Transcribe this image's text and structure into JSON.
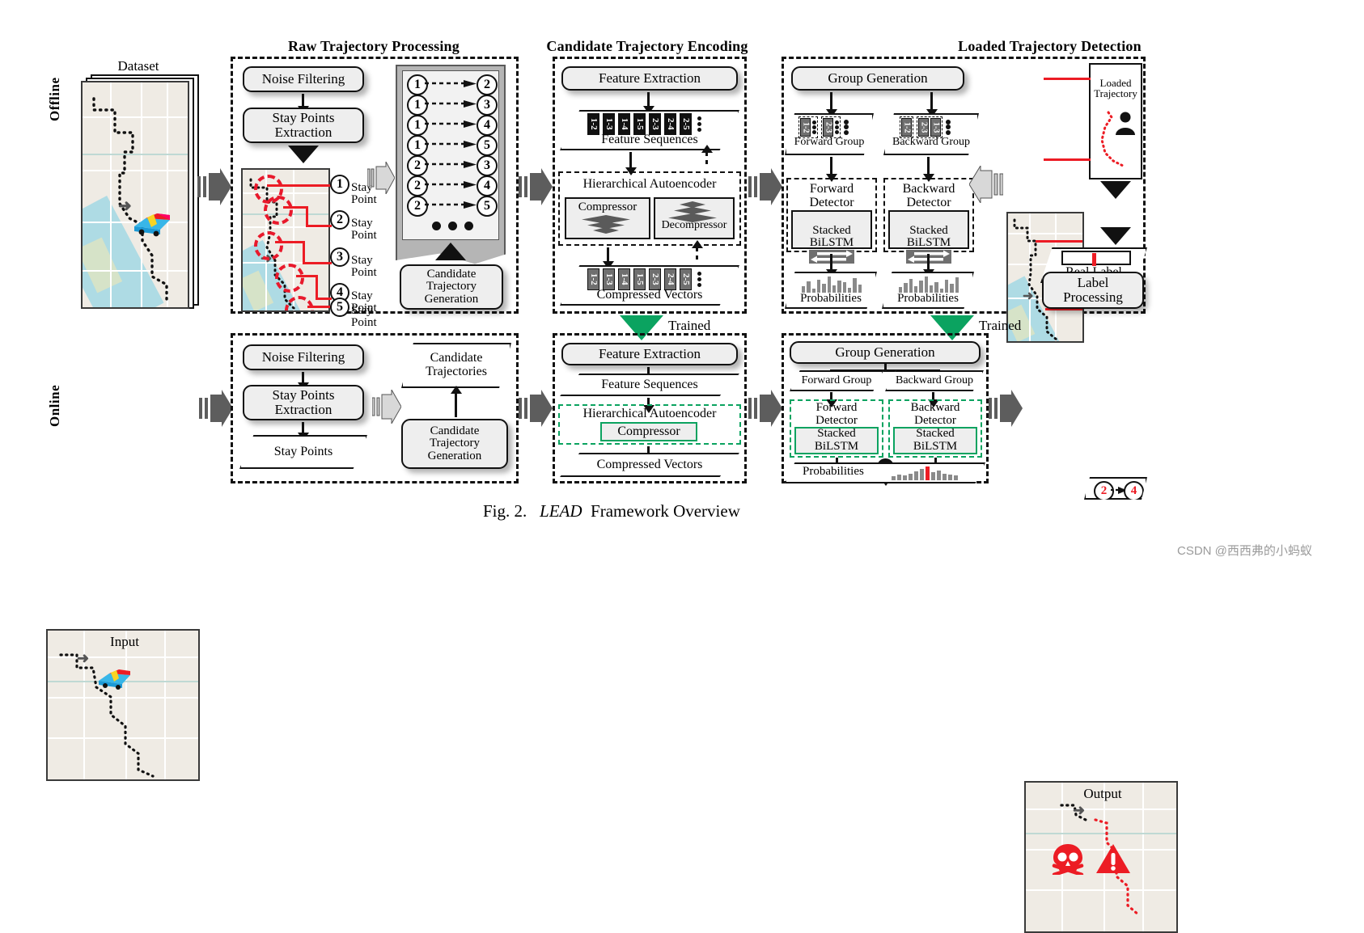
{
  "figure": {
    "caption_prefix": "Fig. 2.",
    "caption_name": "LEAD",
    "caption_rest": "Framework Overview",
    "watermark": "CSDN @西西弗的小蚂蚁"
  },
  "colors": {
    "green": "#0ba360",
    "red": "#ec1c24",
    "grey_box": "#eeeeee",
    "dark_card": "#111111",
    "grey_card": "#6f6f6f"
  },
  "row_labels": {
    "offline": "Offline",
    "online": "Online"
  },
  "stage_titles": {
    "raw": "Raw Trajectory Processing",
    "encoding": "Candidate Trajectory Encoding",
    "detection": "Loaded Trajectory Detection"
  },
  "offline": {
    "dataset": {
      "title": "Dataset"
    },
    "raw": {
      "noise_filtering": "Noise Filtering",
      "stay_points_extraction": "Stay Points\nExtraction",
      "candidate_trajectory_generation": "Candidate\nTrajectory\nGeneration",
      "stay_point_label": "Stay\nPoint",
      "stay_points": [
        "1",
        "2",
        "3",
        "4",
        "5"
      ],
      "candidate_pairs": [
        {
          "from": "1",
          "to": "2"
        },
        {
          "from": "1",
          "to": "3"
        },
        {
          "from": "1",
          "to": "4"
        },
        {
          "from": "1",
          "to": "5"
        },
        {
          "from": "2",
          "to": "3"
        },
        {
          "from": "2",
          "to": "4"
        },
        {
          "from": "2",
          "to": "5"
        }
      ]
    },
    "encoding": {
      "feature_extraction": "Feature Extraction",
      "feature_sequences": "Feature Sequences",
      "hierarchical_autoencoder": "Hierarchical Autoencoder",
      "compressor": "Compressor",
      "decompressor": "Decompressor",
      "compressed_vectors": "Compressed Vectors",
      "sequence_labels": [
        "1-2",
        "1-3",
        "1-4",
        "1-5",
        "2-3",
        "2-4",
        "2-5"
      ]
    },
    "detection": {
      "group_generation": "Group Generation",
      "forward_group": "Forward Group",
      "backward_group": "Backward Group",
      "forward_group_cards": [
        "1-2",
        "2-3"
      ],
      "backward_group_cards": [
        "1-2",
        "2-3",
        "1-3"
      ],
      "forward_detector": "Forward\nDetector",
      "backward_detector": "Backward\nDetector",
      "stacked_bilstm": "Stacked\nBiLSTM",
      "probabilities": "Probabilities",
      "forward_prob_values": [
        6,
        11,
        4,
        13,
        9,
        16,
        7,
        12,
        10,
        5,
        14,
        8
      ],
      "backward_prob_values": [
        5,
        9,
        13,
        6,
        11,
        15,
        7,
        10,
        4,
        12,
        8,
        14
      ]
    },
    "labeling": {
      "loaded_trajectory": "Loaded\nTrajectory",
      "pair_from": "2",
      "pair_to": "4",
      "real_label": "Real Label",
      "label_processing": "Label\nProcessing",
      "real_label_index": 4,
      "real_label_slots": 9
    },
    "trained_label": "Trained"
  },
  "online": {
    "input": {
      "title": "Input"
    },
    "raw": {
      "noise_filtering": "Noise Filtering",
      "stay_points_extraction": "Stay Points\nExtraction",
      "stay_points": "Stay Points",
      "candidate_trajectories": "Candidate\nTrajectories",
      "candidate_trajectory_generation": "Candidate\nTrajectory\nGeneration"
    },
    "encoding": {
      "feature_extraction": "Feature Extraction",
      "feature_sequences": "Feature Sequences",
      "hierarchical_autoencoder": "Hierarchical Autoencoder",
      "compressor": "Compressor",
      "compressed_vectors": "Compressed Vectors"
    },
    "detection": {
      "group_generation": "Group Generation",
      "forward_group": "Forward Group",
      "backward_group": "Backward Group",
      "forward_detector": "Forward\nDetector",
      "backward_detector": "Backward\nDetector",
      "stacked_bilstm": "Stacked\nBiLSTM",
      "probabilities": "Probabilities",
      "merge_symbol": "+",
      "prob_values": [
        5,
        7,
        6,
        9,
        12,
        15,
        18,
        11,
        13,
        9,
        7,
        6
      ],
      "prob_highlight_index": 6
    },
    "output": {
      "title": "Output"
    }
  }
}
